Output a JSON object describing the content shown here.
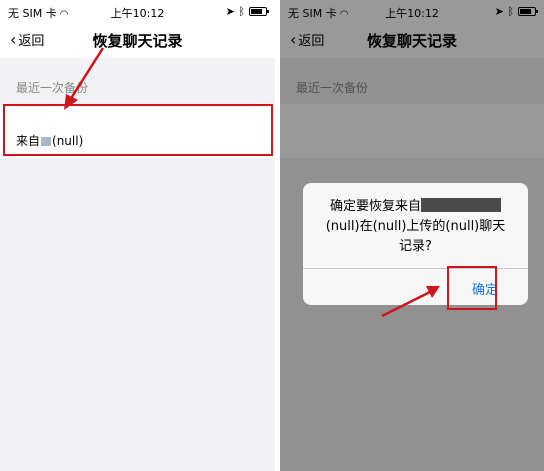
{
  "status_bar": {
    "carrier": "无 SIM 卡",
    "time": "上午10:12"
  },
  "nav": {
    "back_label": "返回",
    "title": "恢复聊天记录"
  },
  "section_header": "最近一次备份",
  "backup_item": {
    "prefix": "来自",
    "suffix": "(null)"
  },
  "alert": {
    "line1": "确定要恢复来自",
    "line2": "(null)在(null)上传的(null)聊天",
    "line3": "记录?",
    "confirm_label": "确定"
  },
  "colors": {
    "accent_blue": "#1a75d8",
    "highlight_red": "#d0141c"
  },
  "icons": [
    "chevron-left-icon",
    "wifi-icon",
    "location-icon",
    "bluetooth-icon",
    "battery-icon"
  ]
}
